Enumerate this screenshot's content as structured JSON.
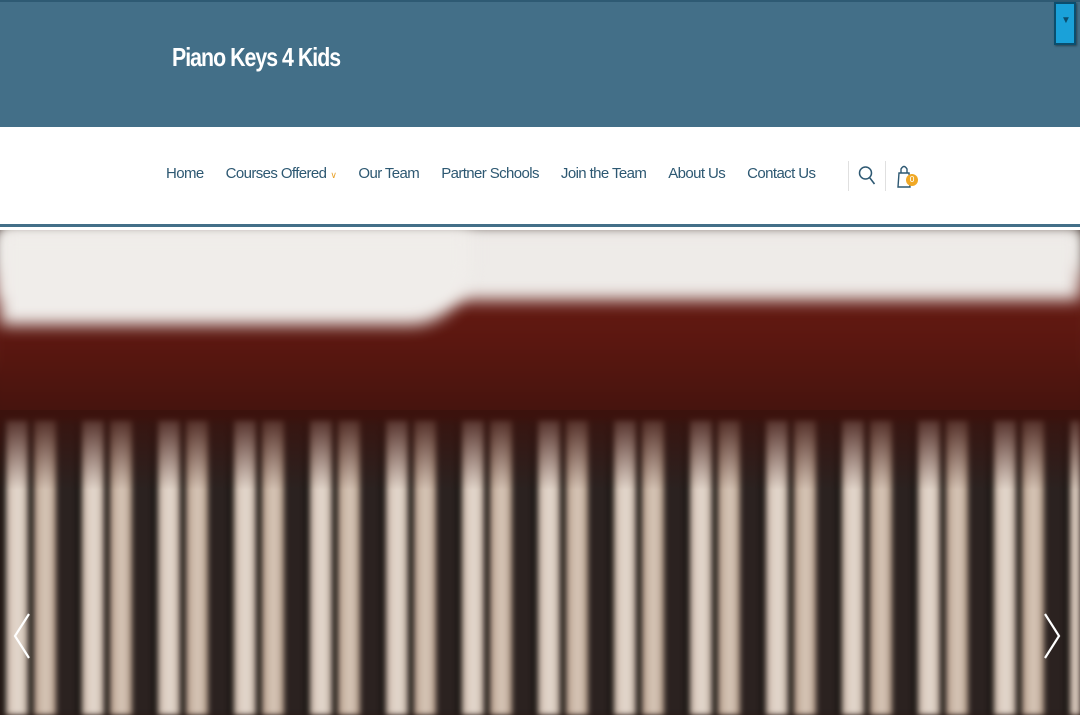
{
  "header": {
    "site_title": "Piano Keys 4 Kids",
    "brand_color": "#436f88"
  },
  "nav": {
    "items": [
      {
        "label": "Home"
      },
      {
        "label": "Courses Offered",
        "has_dropdown": true
      },
      {
        "label": "Our Team"
      },
      {
        "label": "Partner Schools"
      },
      {
        "label": "Join the Team"
      },
      {
        "label": "About Us"
      },
      {
        "label": "Contact Us"
      }
    ],
    "text_color": "#2d5872",
    "dropdown_chevron_color": "#e8a22b"
  },
  "tools": {
    "search_icon": "search-icon",
    "cart_icon": "shopping-bag-icon",
    "cart_count": "0",
    "badge_color": "#f0a825"
  },
  "hero": {
    "image": "blurred piano keys",
    "prev_icon": "‹",
    "next_icon": "›"
  }
}
